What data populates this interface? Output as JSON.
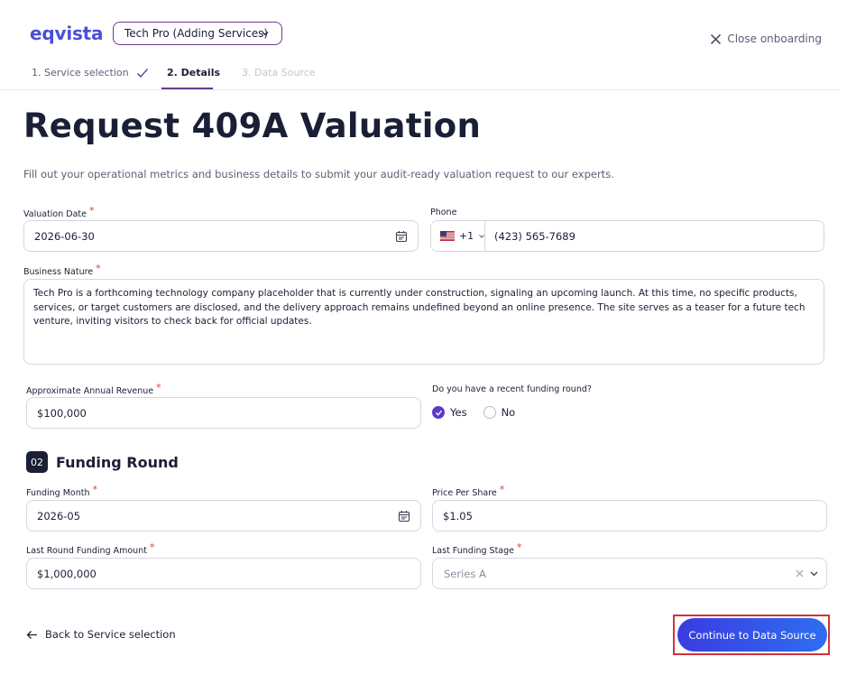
{
  "header": {
    "logo": "eqvista",
    "company_selector": "Tech Pro (Adding Services)",
    "close_label": "Close onboarding"
  },
  "steps": [
    {
      "label": "1. Service selection",
      "state": "completed"
    },
    {
      "label": "2. Details",
      "state": "active"
    },
    {
      "label": "3. Data Source",
      "state": "upcoming"
    }
  ],
  "page": {
    "title": "Request 409A Valuation",
    "subtitle": "Fill out your operational metrics and business details to submit your audit-ready valuation request to our experts."
  },
  "form": {
    "valuation_date": {
      "label": "Valuation Date",
      "value": "2026-06-30"
    },
    "phone": {
      "label": "Phone",
      "country_code": "+1",
      "value": "(423) 565-7689"
    },
    "business_nature": {
      "label": "Business Nature",
      "value": "Tech Pro is a forthcoming technology company placeholder that is currently under construction, signaling an upcoming launch. At this time, no specific products, services, or target customers are disclosed, and the delivery approach remains undefined beyond an online presence. The site serves as a teaser for a future tech venture, inviting visitors to check back for official updates."
    },
    "annual_revenue": {
      "label": "Approximate Annual Revenue",
      "value": "$100,000"
    },
    "funding_question": {
      "label": "Do you have a recent funding round?",
      "yes": "Yes",
      "no": "No",
      "selected": "Yes"
    }
  },
  "funding_section": {
    "number": "02",
    "title": "Funding Round",
    "funding_month": {
      "label": "Funding Month",
      "value": "2026-05"
    },
    "price_per_share": {
      "label": "Price Per Share",
      "value": "$1.05"
    },
    "last_round_amount": {
      "label": "Last Round Funding Amount",
      "value": "$1,000,000"
    },
    "last_stage": {
      "label": "Last Funding Stage",
      "value": "Series A"
    }
  },
  "footer": {
    "back_label": "Back to Service selection",
    "continue_label": "Continue to Data Source"
  },
  "colors": {
    "accent": "#5a3cc8",
    "brand_logo": "#4a4fd9",
    "selector_border": "#6a3c8f",
    "required": "#e03a3a",
    "primary_button": "#3a3ce0",
    "highlight_border": "#d0333a"
  }
}
